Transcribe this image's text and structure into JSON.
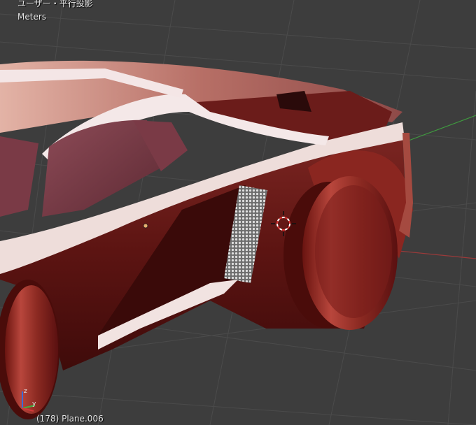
{
  "viewport": {
    "view_name": "ユーザー・平行投影",
    "units": "Meters",
    "object_info": "(178) Plane.006"
  },
  "gizmo": {
    "z_label": "z",
    "y_label": "y"
  },
  "colors": {
    "background": "#3d3d3d",
    "grid": "#4a4a4a",
    "axis_x": "#9b3a3a",
    "axis_y": "#3f9b3f",
    "body_dark": "#5a1010",
    "body_mid": "#8a2a25",
    "body_light": "#c9857c",
    "highlight": "#f2e6e6"
  }
}
